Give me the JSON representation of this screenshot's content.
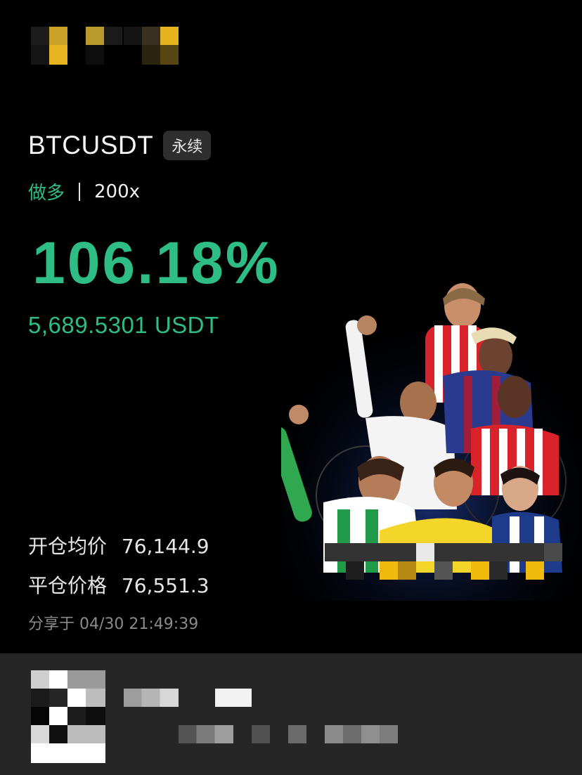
{
  "card": {
    "pair": "BTCUSDT",
    "contract_type": "永续",
    "side": "做多",
    "leverage": "200x",
    "pnl_percent": "106.18%",
    "pnl_amount": "5,689.5301 USDT",
    "entry_label": "开仓均价",
    "entry_price": "76,144.9",
    "exit_label": "平仓价格",
    "exit_price": "76,551.3",
    "shared_at": "分享于 04/30 21:49:39"
  },
  "colors": {
    "profit_green": "#2ebd85",
    "background": "#000000",
    "footer_bg": "#262626",
    "badge_bg": "#2e2e2e",
    "brand_yellow": "#f0b90b"
  },
  "icons": {
    "logo": "exchange-logo-pixelated",
    "qr": "qr-code-pixelated"
  }
}
